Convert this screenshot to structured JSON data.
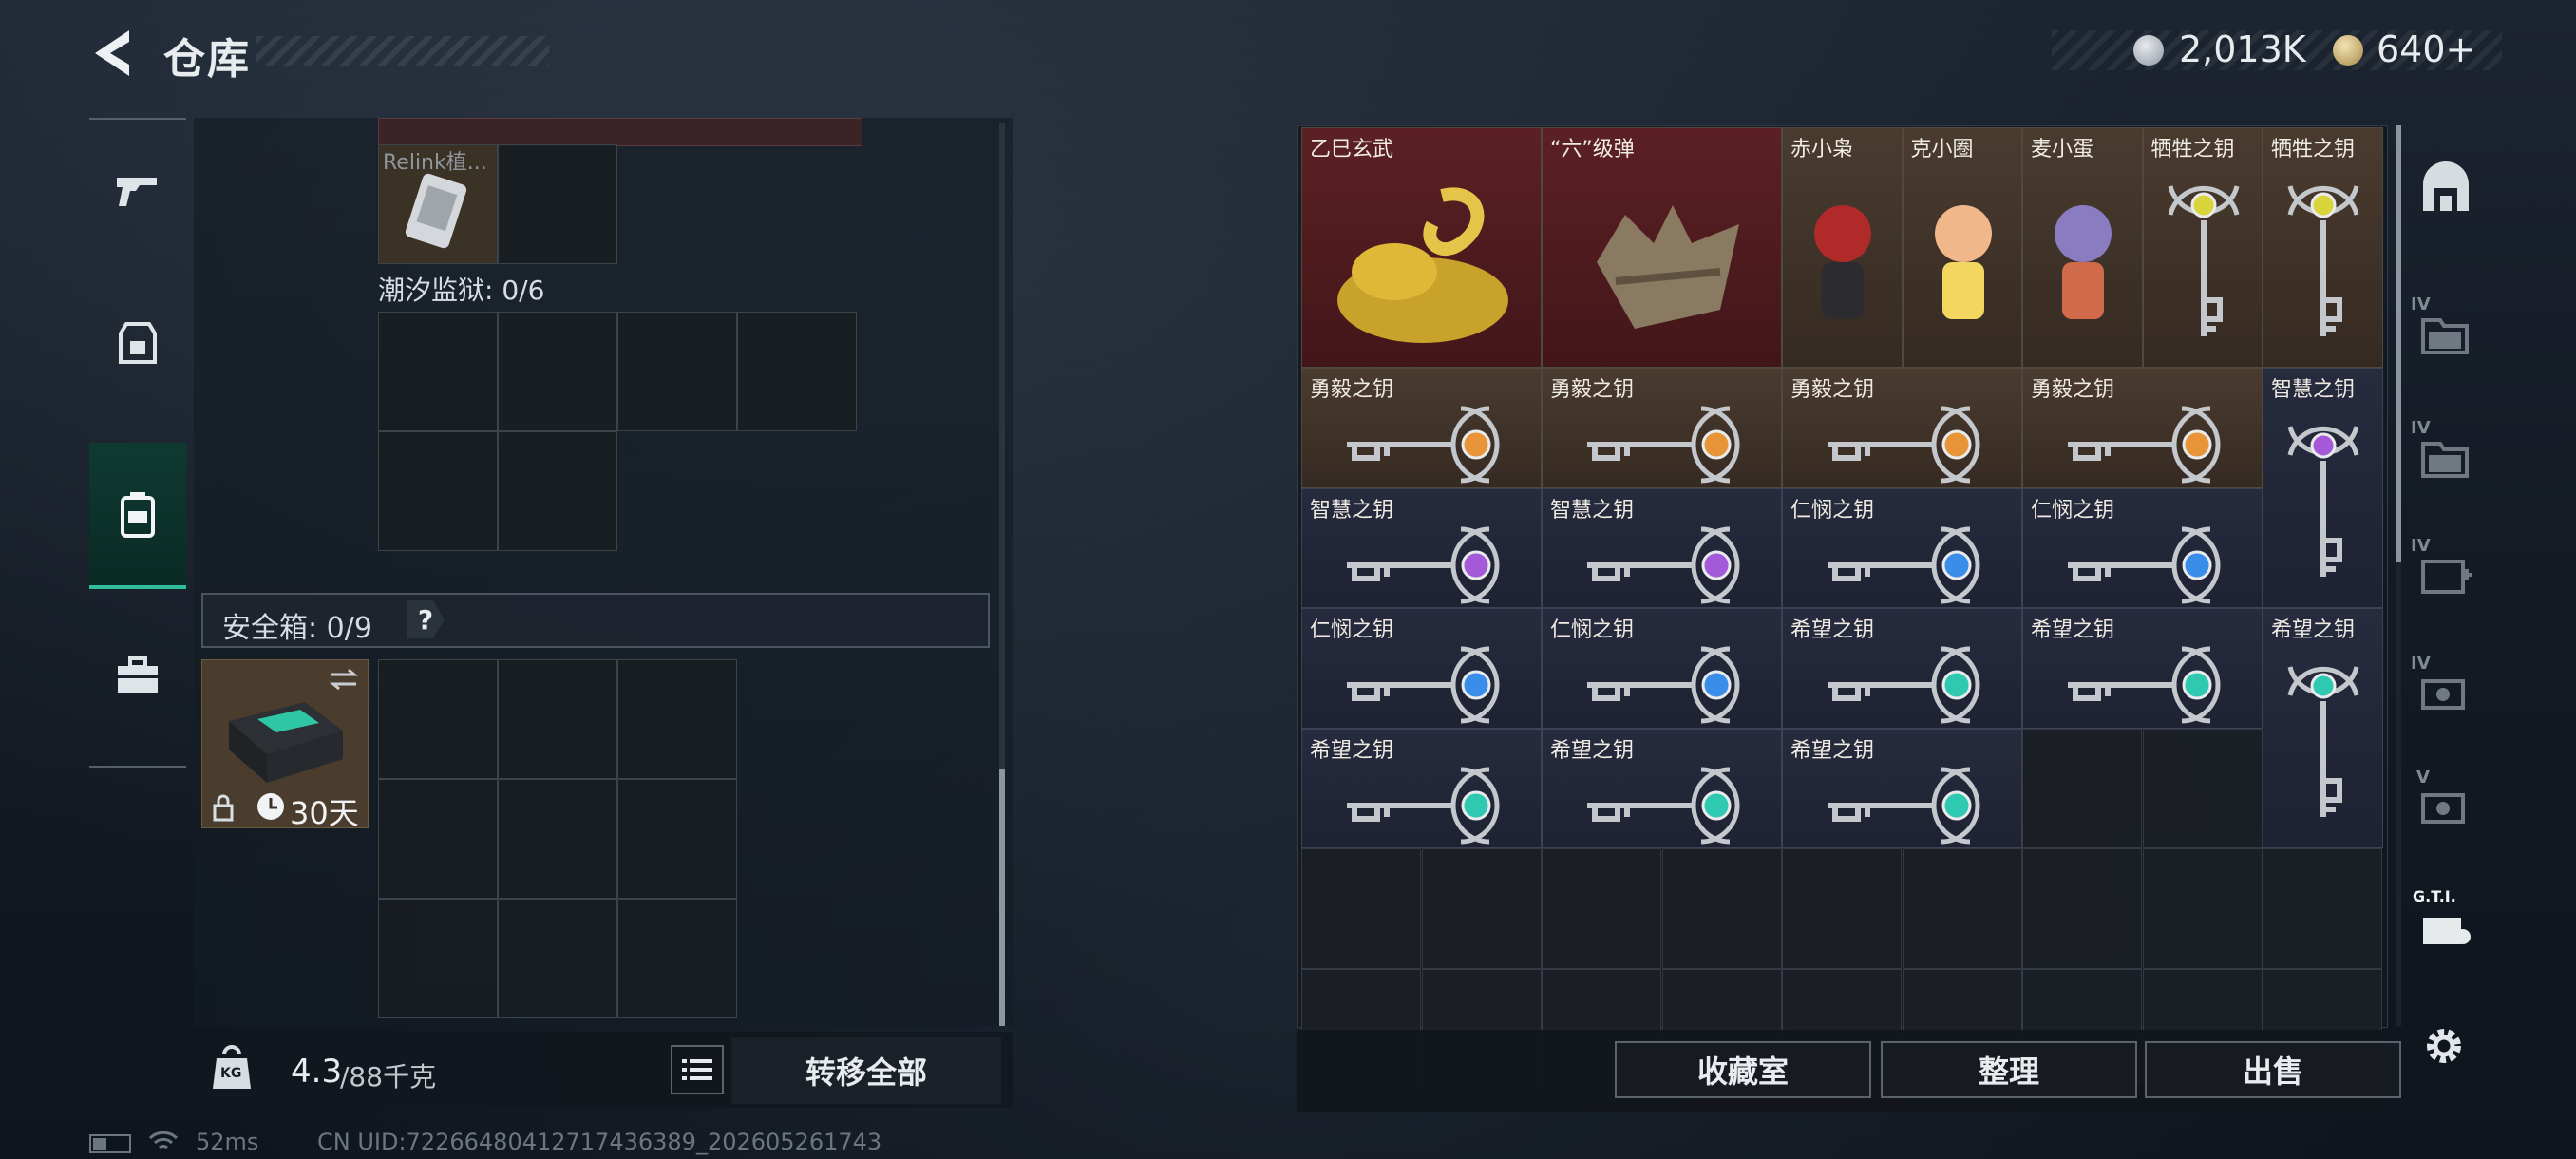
{
  "header": {
    "title": "仓库",
    "currency_silver": "2,013K",
    "currency_gold": "640+"
  },
  "left_panel": {
    "top_item_label": "Relink植...",
    "section_prison": "潮汐监狱: 0/6",
    "safe_box_label": "安全箱: 0/9",
    "help_icon": "?",
    "safe_box_duration": "30天",
    "weight_value": "4.3",
    "weight_max": "/88千克",
    "weight_badge": "KG",
    "transfer_all": "转移全部"
  },
  "right_panel": {
    "items": [
      {
        "name": "乙巳玄武",
        "color": "red"
      },
      {
        "name": "“六”级弹",
        "color": "red"
      },
      {
        "name": "赤小枭",
        "color": "brown"
      },
      {
        "name": "克小圈",
        "color": "brown"
      },
      {
        "name": "麦小蛋",
        "color": "brown"
      },
      {
        "name": "牺牲之钥",
        "color": "brown"
      },
      {
        "name": "牺牲之钥",
        "color": "brown"
      },
      {
        "name": "勇毅之钥",
        "color": "brown"
      },
      {
        "name": "勇毅之钥",
        "color": "brown"
      },
      {
        "name": "勇毅之钥",
        "color": "brown"
      },
      {
        "name": "勇毅之钥",
        "color": "brown"
      },
      {
        "name": "智慧之钥",
        "color": "blue"
      },
      {
        "name": "智慧之钥",
        "color": "blue"
      },
      {
        "name": "智慧之钥",
        "color": "blue"
      },
      {
        "name": "仁悯之钥",
        "color": "blue"
      },
      {
        "name": "仁悯之钥",
        "color": "blue"
      },
      {
        "name": "仁悯之钥",
        "color": "blue"
      },
      {
        "name": "仁悯之钥",
        "color": "blue"
      },
      {
        "name": "希望之钥",
        "color": "blue"
      },
      {
        "name": "希望之钥",
        "color": "blue"
      },
      {
        "name": "希望之钥",
        "color": "blue"
      },
      {
        "name": "希望之钥",
        "color": "blue"
      },
      {
        "name": "希望之钥",
        "color": "blue"
      },
      {
        "name": "希望之钥",
        "color": "blue"
      }
    ],
    "gem_colors": {
      "勇毅之钥": "#e8953a",
      "智慧之钥": "#a45ad8",
      "仁悯之钥": "#3a8de8",
      "希望之钥": "#2fc8b0",
      "牺牲之钥": "#d8d43a"
    },
    "side_tab_labels": [
      "IV",
      "IV",
      "IV",
      "IV",
      "V",
      "G.T.I."
    ],
    "buttons": {
      "collection": "收藏室",
      "organize": "整理",
      "sell": "出售"
    }
  },
  "status_bar": {
    "ping": "52ms",
    "uid": "CN UID:722664804127174363​89_202605261743"
  }
}
